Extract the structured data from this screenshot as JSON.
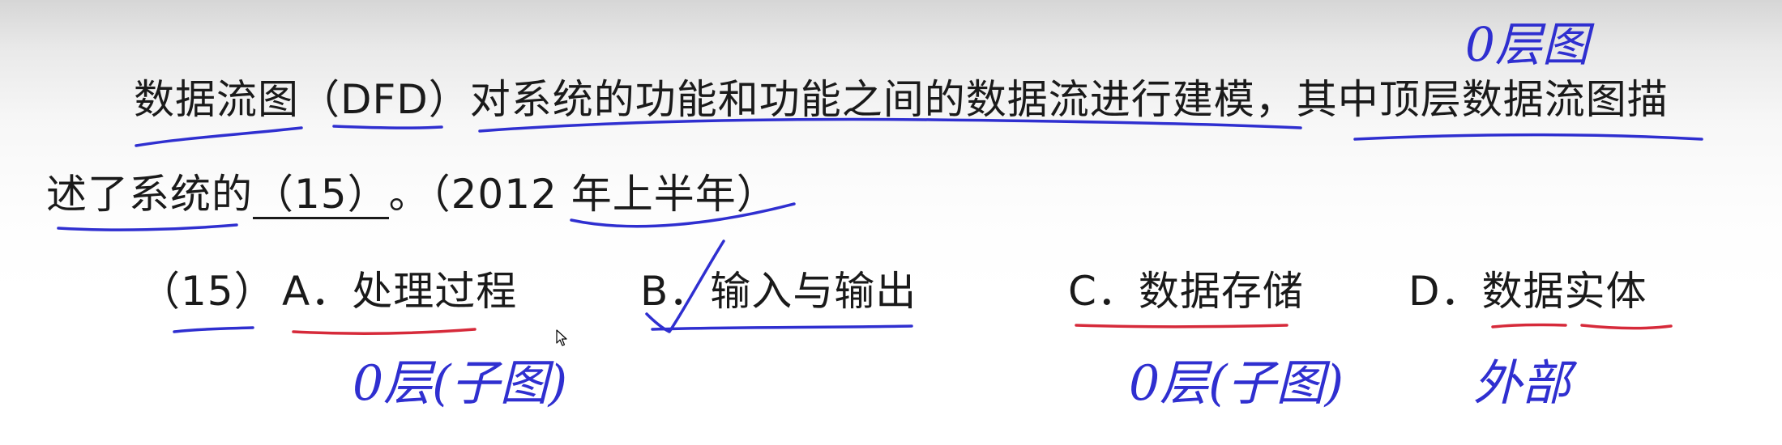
{
  "question": {
    "line1": "数据流图（DFD）对系统的功能和功能之间的数据流进行建模，其中顶层数据流图描",
    "line2_prefix": "述了系统的",
    "blank": "（15）",
    "line2_suffix": "。（2012 年上半年）"
  },
  "options": {
    "number": "（15）",
    "a": "A．处理过程",
    "b": "B．输入与输出",
    "c": "C．数据存储",
    "d": "D．数据实体"
  },
  "handwritten_notes": {
    "top": "0层图",
    "under_a": "0层(子图)",
    "under_c": "0层(子图)",
    "under_d": "外部"
  },
  "annotation_colors": {
    "blue_pen": "#2f2fd0",
    "red_pen": "#d62a3a"
  }
}
